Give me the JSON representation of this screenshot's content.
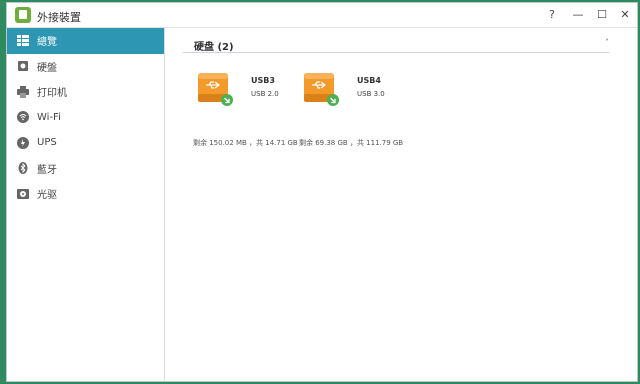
{
  "window": {
    "title": "外接裝置",
    "controls": {
      "help": "?",
      "minimize": "—",
      "maximize": "☐",
      "close": "✕"
    }
  },
  "sidebar": {
    "items": [
      {
        "label": "總覽",
        "icon": "overview-icon",
        "active": true
      },
      {
        "label": "硬盤",
        "icon": "disk-icon",
        "active": false
      },
      {
        "label": "打印机",
        "icon": "printer-icon",
        "active": false
      },
      {
        "label": "Wi-Fi",
        "icon": "wifi-icon",
        "active": false
      },
      {
        "label": "UPS",
        "icon": "ups-icon",
        "active": false
      },
      {
        "label": "藍牙",
        "icon": "bluetooth-icon",
        "active": false
      },
      {
        "label": "光驱",
        "icon": "optical-drive-icon",
        "active": false
      }
    ]
  },
  "main": {
    "section_title": "硬盘 (2)",
    "collapse_glyph": "˄",
    "drives": [
      {
        "name": "USB3",
        "type": "USB 2.0",
        "space": "剩余 150.02 MB ，共 14.71 GB",
        "icon": "usb-drive-icon"
      },
      {
        "name": "USB4",
        "type": "USB 3.0",
        "space": "剩余 69.38 GB ，共 111.79 GB",
        "icon": "usb-drive-icon"
      }
    ]
  },
  "colors": {
    "desktop": "#2e8b5f",
    "sidebar_active": "#2c96b3",
    "drive_orange": "#f39a2b",
    "badge_green": "#4caf50"
  }
}
